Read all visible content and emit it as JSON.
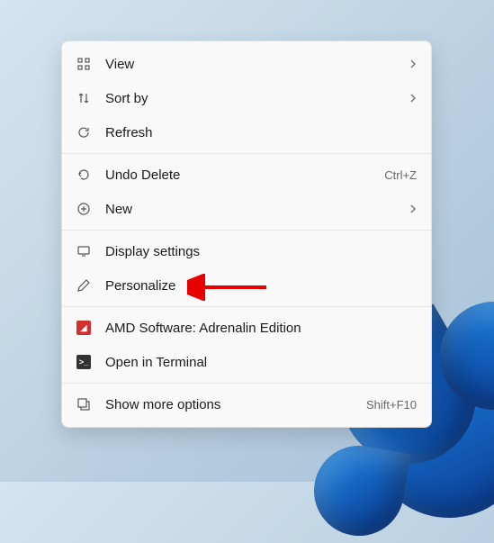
{
  "menu": {
    "groups": [
      [
        {
          "icon": "view-icon",
          "label": "View",
          "submenu": true
        },
        {
          "icon": "sort-icon",
          "label": "Sort by",
          "submenu": true
        },
        {
          "icon": "refresh-icon",
          "label": "Refresh"
        }
      ],
      [
        {
          "icon": "undo-icon",
          "label": "Undo Delete",
          "shortcut": "Ctrl+Z"
        },
        {
          "icon": "new-icon",
          "label": "New",
          "submenu": true
        }
      ],
      [
        {
          "icon": "display-icon",
          "label": "Display settings"
        },
        {
          "icon": "personalize-icon",
          "label": "Personalize"
        }
      ],
      [
        {
          "icon": "amd-icon",
          "label": "AMD Software: Adrenalin Edition"
        },
        {
          "icon": "terminal-icon",
          "label": "Open in Terminal"
        }
      ],
      [
        {
          "icon": "more-options-icon",
          "label": "Show more options",
          "shortcut": "Shift+F10"
        }
      ]
    ]
  },
  "annotation": {
    "target": "Personalize",
    "color": "#e60000"
  }
}
